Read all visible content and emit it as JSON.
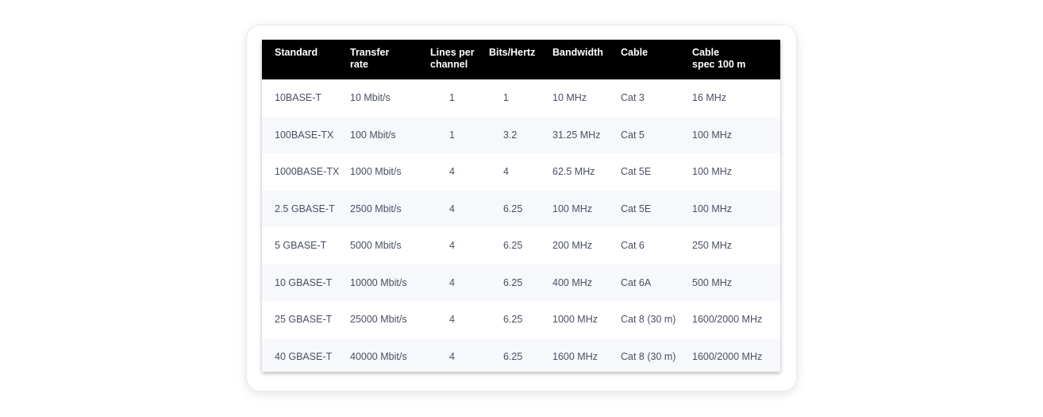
{
  "table": {
    "headers": [
      "Standard",
      "Transfer\nrate",
      "Lines per\nchannel",
      "Bits/Hertz",
      "Bandwidth",
      "Cable",
      "Cable\nspec 100 m"
    ],
    "rows": [
      [
        "10BASE-T",
        "10 Mbit/s",
        "1",
        "1",
        "10 MHz",
        "Cat 3",
        "16 MHz"
      ],
      [
        "100BASE-TX",
        "100 Mbit/s",
        "1",
        "3.2",
        "31.25 MHz",
        "Cat 5",
        "100 MHz"
      ],
      [
        "1000BASE-TX",
        "1000 Mbit/s",
        "4",
        "4",
        "62.5 MHz",
        "Cat 5E",
        "100 MHz"
      ],
      [
        "2.5 GBASE-T",
        "2500 Mbit/s",
        "4",
        "6.25",
        "100 MHz",
        "Cat 5E",
        "100 MHz"
      ],
      [
        "5 GBASE-T",
        "5000 Mbit/s",
        "4",
        "6.25",
        "200 MHz",
        "Cat 6",
        "250 MHz"
      ],
      [
        "10 GBASE-T",
        "10000 Mbit/s",
        "4",
        "6.25",
        "400 MHz",
        "Cat 6A",
        "500 MHz"
      ],
      [
        "25 GBASE-T",
        "25000 Mbit/s",
        "4",
        "6.25",
        "1000 MHz",
        "Cat 8 (30 m)",
        "1600/2000 MHz"
      ],
      [
        "40 GBASE-T",
        "40000 Mbit/s",
        "4",
        "6.25",
        "1600 MHz",
        "Cat 8 (30 m)",
        "1600/2000 MHz"
      ]
    ]
  },
  "colors": {
    "header_bg": "#000000",
    "header_text": "#ffffff",
    "body_text": "#4a4f63",
    "stripe": "#f7f8fb"
  }
}
